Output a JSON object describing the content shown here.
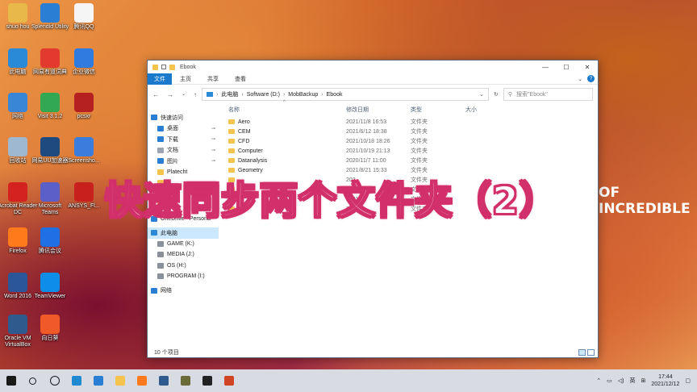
{
  "desktop_icons": [
    {
      "label": "shuo hou",
      "icon": "user-folder-icon",
      "color": "#e8b84a"
    },
    {
      "label": "Splendid Utility",
      "icon": "splendid-icon",
      "color": "#2a7fd4"
    },
    {
      "label": "腾讯QQ",
      "icon": "qq-icon",
      "color": "#f5f5f5"
    },
    {
      "label": "此电脑",
      "icon": "computer-icon",
      "color": "#2a8ad8"
    },
    {
      "label": "网易有道词典",
      "icon": "youdao-icon",
      "color": "#e23a2e"
    },
    {
      "label": "企业微信",
      "icon": "wecom-icon",
      "color": "#2f7be0"
    },
    {
      "label": "网络",
      "icon": "network-icon",
      "color": "#3a86d6"
    },
    {
      "label": "Visit 3.1.2",
      "icon": "visit-icon",
      "color": "#33a852"
    },
    {
      "label": "pcsxr",
      "icon": "pcsxr-icon",
      "color": "#b52020"
    },
    {
      "label": "回收站",
      "icon": "recycle-bin-icon",
      "color": "#9db8d0"
    },
    {
      "label": "网易UU加速器",
      "icon": "uu-icon",
      "color": "#1e4a80"
    },
    {
      "label": "Screensho...",
      "icon": "screenshot-icon",
      "color": "#3b7ddd"
    },
    {
      "label": "Acrobat Reader DC",
      "icon": "acrobat-icon",
      "color": "#d4221e"
    },
    {
      "label": "Microsoft Teams",
      "icon": "teams-icon",
      "color": "#5b5fc7"
    },
    {
      "label": "ANSYS_Fl...",
      "icon": "pdf-icon",
      "color": "#c8201c"
    },
    {
      "label": "Firefox",
      "icon": "firefox-icon",
      "color": "#ff7a1a"
    },
    {
      "label": "腾讯会议",
      "icon": "tencent-meeting-icon",
      "color": "#1f6fe5"
    },
    {
      "label": "Word 2016",
      "icon": "word-icon",
      "color": "#2b579a"
    },
    {
      "label": "TeamViewer",
      "icon": "teamviewer-icon",
      "color": "#0e8ee9"
    },
    {
      "label": "Oracle VM VirtualBox",
      "icon": "virtualbox-icon",
      "color": "#2f5a8e"
    },
    {
      "label": "向日葵",
      "icon": "sunflower-icon",
      "color": "#f05a28"
    }
  ],
  "window": {
    "title": "Ebook",
    "controls": {
      "minimize": "—",
      "maximize": "☐",
      "close": "✕"
    },
    "ribbon_tabs": [
      "文件",
      "主页",
      "共享",
      "查看"
    ],
    "address": [
      "此电脑",
      "Software (D:)",
      "MobBackup",
      "Ebook"
    ],
    "search_placeholder": "搜索\"Ebook\"",
    "nav_pane": [
      {
        "label": "快速访问",
        "icon": "star-icon",
        "color": "#2a7fd4",
        "pin": false
      },
      {
        "label": "桌面",
        "icon": "desktop-icon",
        "color": "#2a7fd4",
        "pin": true
      },
      {
        "label": "下载",
        "icon": "download-icon",
        "color": "#2a7fd4",
        "pin": true
      },
      {
        "label": "文档",
        "icon": "document-icon",
        "color": "#9aa5b1",
        "pin": true
      },
      {
        "label": "图片",
        "icon": "picture-icon",
        "color": "#2a7fd4",
        "pin": true
      },
      {
        "label": "Platecht",
        "icon": "folder-icon",
        "color": "#f4c44e",
        "pin": false
      },
      {
        "label": "",
        "icon": "folder-icon",
        "color": "#f4c44e",
        "pin": false
      },
      {
        "label": "",
        "icon": "folder-icon",
        "color": "#f4c44e",
        "pin": false
      },
      {
        "label": "",
        "icon": "folder-icon",
        "color": "#f4c44e",
        "pin": false
      },
      {
        "label": "OneDrive - Persona",
        "icon": "onedrive-icon",
        "color": "#2a7fd4",
        "pin": false
      },
      {
        "label": "此电脑",
        "icon": "computer-icon",
        "color": "#2a8ad8",
        "pin": false,
        "selected": true
      },
      {
        "label": "GAME (K:)",
        "icon": "drive-icon",
        "color": "#8a9099",
        "pin": false
      },
      {
        "label": "MEDIA (J:)",
        "icon": "drive-icon",
        "color": "#8a9099",
        "pin": false
      },
      {
        "label": "OS (H:)",
        "icon": "drive-icon",
        "color": "#8a9099",
        "pin": false
      },
      {
        "label": "PROGRAM (I:)",
        "icon": "drive-icon",
        "color": "#8a9099",
        "pin": false
      },
      {
        "label": "网络",
        "icon": "network-icon",
        "color": "#2a7fd4",
        "pin": false
      }
    ],
    "columns": [
      "名称",
      "修改日期",
      "类型",
      "大小"
    ],
    "files": [
      {
        "name": "Aero",
        "date": "2021/11/8 16:53",
        "type": "文件夹"
      },
      {
        "name": "CEM",
        "date": "2021/6/12 18:38",
        "type": "文件夹"
      },
      {
        "name": "CFD",
        "date": "2021/10/18 18:26",
        "type": "文件夹"
      },
      {
        "name": "Computer",
        "date": "2021/10/19 21:13",
        "type": "文件夹"
      },
      {
        "name": "Datanalysis",
        "date": "2020/11/7 11:00",
        "type": "文件夹"
      },
      {
        "name": "Geometry",
        "date": "2021/8/21 15:33",
        "type": "文件夹"
      },
      {
        "name": "",
        "date": "202",
        "type": "文件夹"
      },
      {
        "name": "",
        "date": "202",
        "type": "文件夹"
      },
      {
        "name": "",
        "date": "2021/8/",
        "type": "文件夹"
      },
      {
        "name": "",
        "date": "202",
        "type": "文件夹"
      }
    ],
    "status": "10 个项目"
  },
  "overlay_title": "快速同步两个文件夹（2）",
  "background_text": "OF INCREDIBLE",
  "taskbar": {
    "icons": [
      {
        "name": "windows-start-icon",
        "color": "#1a1a1a"
      },
      {
        "name": "search-icon",
        "color": "#1a1a1a"
      },
      {
        "name": "task-view-icon",
        "color": "#1a1a1a"
      },
      {
        "name": "edge-icon",
        "color": "#1f8ad2"
      },
      {
        "name": "store-icon",
        "color": "#2a7fd4"
      },
      {
        "name": "file-explorer-icon",
        "color": "#f4c44e"
      },
      {
        "name": "firefox-icon",
        "color": "#ff7a1a"
      },
      {
        "name": "virtualbox-icon",
        "color": "#2f5a8e"
      },
      {
        "name": "app-icon",
        "color": "#6b6b3a"
      },
      {
        "name": "terminal-icon",
        "color": "#222222"
      },
      {
        "name": "powerpoint-icon",
        "color": "#d04423"
      }
    ],
    "tray": {
      "ime": "英",
      "time": "17:44",
      "date": "2021/12/12"
    }
  }
}
